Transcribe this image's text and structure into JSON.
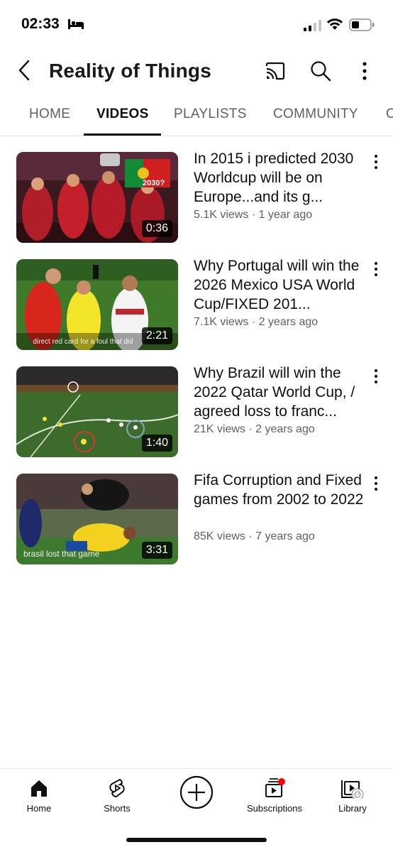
{
  "status_bar": {
    "time": "02:33"
  },
  "header": {
    "title": "Reality of Things"
  },
  "tabs": [
    {
      "label": "HOME"
    },
    {
      "label": "VIDEOS"
    },
    {
      "label": "PLAYLISTS"
    },
    {
      "label": "COMMUNITY"
    },
    {
      "label": "C"
    }
  ],
  "videos": [
    {
      "title": "In 2015 i predicted 2030 Worldcup will be on Europe...and its g...",
      "meta": "5.1K views · 1 year ago",
      "duration": "0:36",
      "thumb_overlay": "2030?"
    },
    {
      "title": "Why Portugal will win the 2026 Mexico USA World Cup/FIXED 201...",
      "meta": "7.1K views · 2 years ago",
      "duration": "2:21",
      "thumb_caption": "direct red card for a foul that did"
    },
    {
      "title": "Why Brazil will win the 2022 Qatar World Cup, / agreed loss to franc...",
      "meta": "21K views · 2 years ago",
      "duration": "1:40"
    },
    {
      "title": "Fifa Corruption and Fixed games from 2002 to 2022",
      "meta": "85K views · 7 years ago",
      "duration": "3:31",
      "thumb_caption": "brasil lost that game"
    }
  ],
  "bottom_nav": [
    {
      "label": "Home",
      "icon": "home-icon"
    },
    {
      "label": "Shorts",
      "icon": "shorts-icon"
    },
    {
      "label": "",
      "icon": "create-icon"
    },
    {
      "label": "Subscriptions",
      "icon": "subscriptions-icon"
    },
    {
      "label": "Library",
      "icon": "library-icon"
    }
  ],
  "colors": {
    "text": "#0f0f0f",
    "secondary": "#606060",
    "notification": "#ff0000"
  }
}
